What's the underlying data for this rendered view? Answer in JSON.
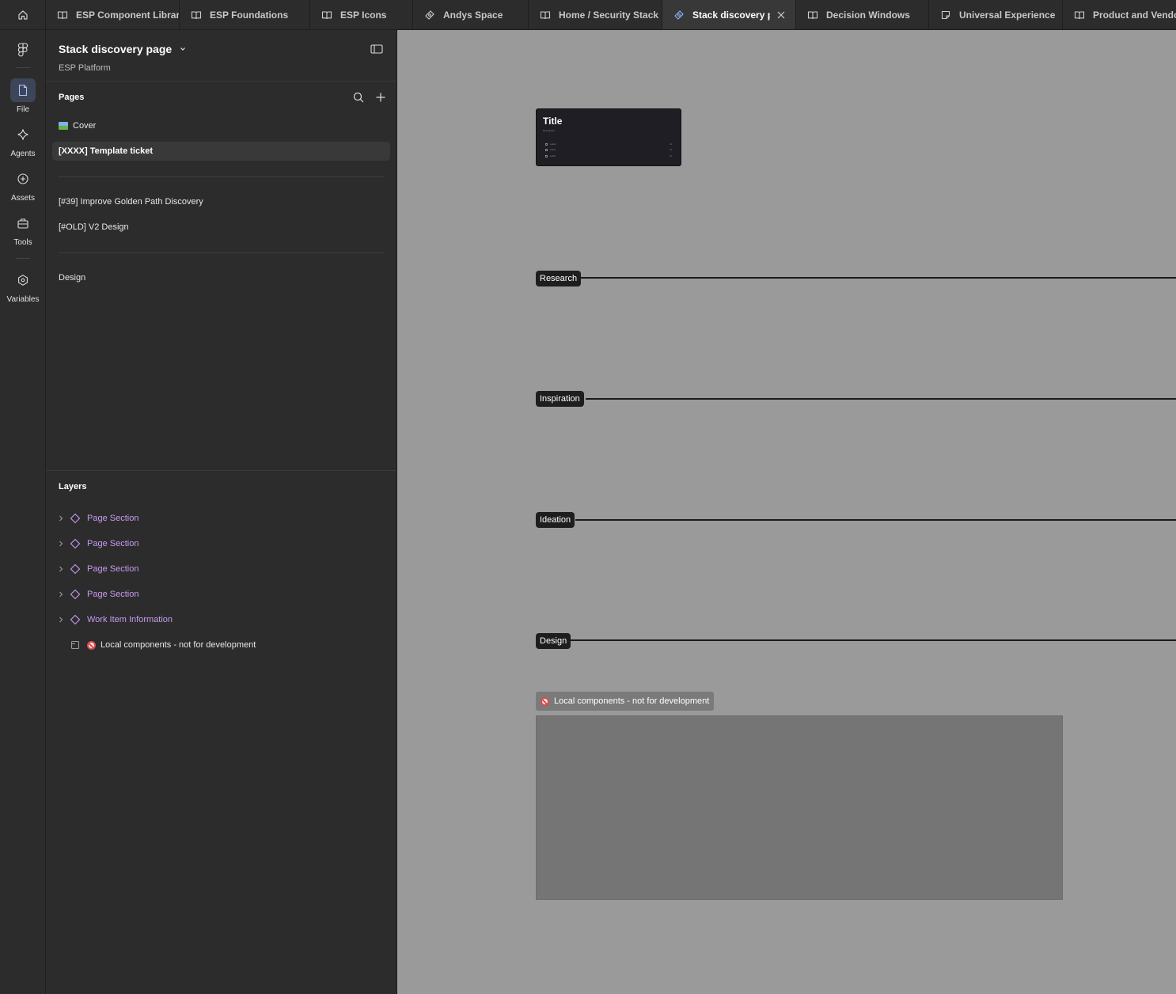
{
  "tabs": [
    {
      "label": "ESP Component Library",
      "icon": "book-icon",
      "active": false
    },
    {
      "label": "ESP Foundations",
      "icon": "book-icon",
      "active": false
    },
    {
      "label": "ESP Icons",
      "icon": "book-icon",
      "active": false
    },
    {
      "label": "Andys Space",
      "icon": "design-file-icon",
      "active": false
    },
    {
      "label": "Home / Security Stack",
      "icon": "book-icon",
      "active": false
    },
    {
      "label": "Stack discovery page",
      "icon": "design-file-icon",
      "active": true
    },
    {
      "label": "Decision Windows",
      "icon": "book-icon",
      "active": false
    },
    {
      "label": "Universal Experience Library",
      "icon": "figjam-icon",
      "active": false
    },
    {
      "label": "Product and Vendor",
      "icon": "book-icon",
      "active": false
    }
  ],
  "rail": {
    "file": "File",
    "agents": "Agents",
    "assets": "Assets",
    "tools": "Tools",
    "variables": "Variables"
  },
  "file": {
    "title": "Stack discovery page",
    "subtitle": "ESP Platform"
  },
  "pages": {
    "heading": "Pages",
    "items": [
      "Cover",
      "[XXXX] Template ticket",
      "[#39] Improve Golden Path Discovery",
      "[#OLD] V2 Design",
      "Design"
    ]
  },
  "layers": {
    "heading": "Layers",
    "items": [
      "Page Section",
      "Page Section",
      "Page Section",
      "Page Section",
      "Work Item Information",
      "Local components - not for development"
    ]
  },
  "canvas": {
    "card_title": "Title",
    "card_description": "Description",
    "card_rows": [
      {
        "label": "Label",
        "value": "v1"
      },
      {
        "label": "Label",
        "value": "v1"
      },
      {
        "label": "Label",
        "value": "v1"
      }
    ],
    "sections": [
      "Research",
      "Inspiration",
      "Ideation",
      "Design"
    ],
    "local_label": "Local components - not for development"
  },
  "colors": {
    "accent_component": "#c79bf0",
    "canvas_bg": "#9a9a9a",
    "panel_bg": "#2c2c2c"
  }
}
